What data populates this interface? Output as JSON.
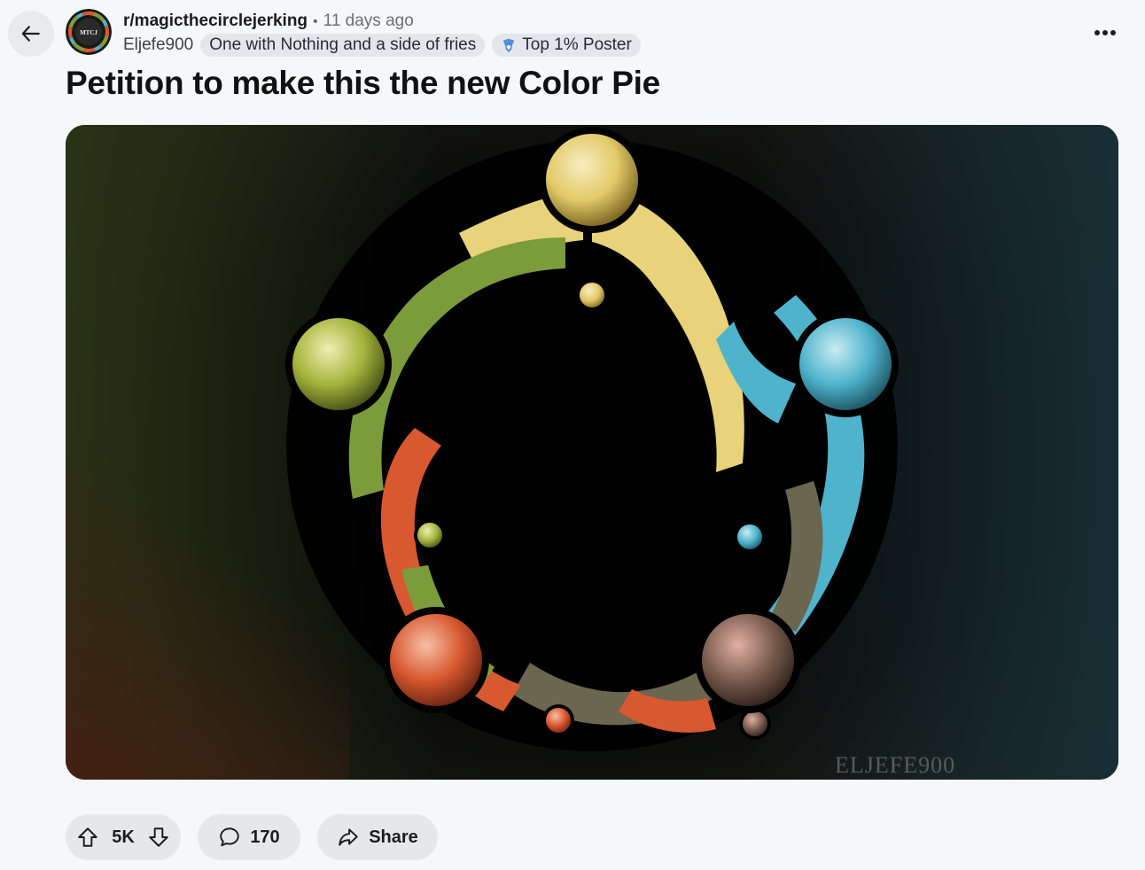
{
  "post": {
    "subreddit": "r/magicthecirclejerking",
    "separator": "•",
    "age": "11 days ago",
    "author": "Eljefe900",
    "user_flair": "One with Nothing and a side of fries",
    "achievement_flair": "Top 1% Poster",
    "title": "Petition to make this the new Color Pie",
    "avatar_text": "MTCJ",
    "image_signature": "ELJEFE900"
  },
  "actions": {
    "score": "5K",
    "comments": "170",
    "share_label": "Share"
  },
  "icons": {
    "back": "arrow-left-icon",
    "more": "more-horizontal-icon",
    "upvote": "arrow-up-icon",
    "downvote": "arrow-down-icon",
    "comment": "speech-bubble-icon",
    "share": "share-arrow-icon",
    "achievement": "trophy-badge-icon"
  },
  "colors": {
    "background": "#f6f7f9",
    "pill": "#e5e8eb",
    "mana_white": "#e8d27a",
    "mana_blue": "#4fb3cc",
    "mana_black": "#6b6650",
    "mana_red": "#d8582f",
    "mana_green": "#7c9c3b"
  }
}
